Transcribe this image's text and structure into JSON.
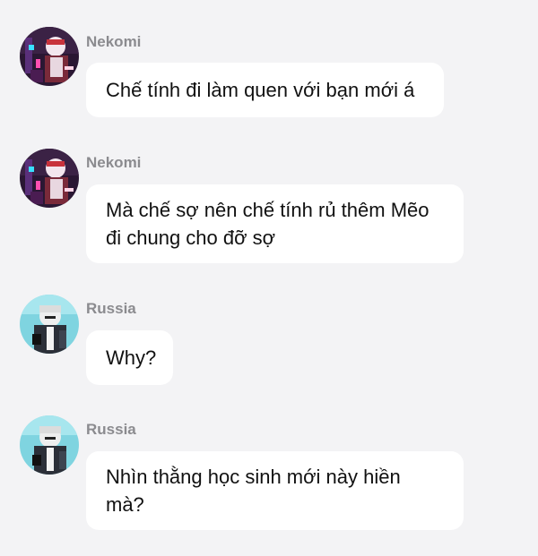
{
  "messages": [
    {
      "sender": "Nekomi",
      "avatar_icon": "nekomi-avatar-icon",
      "text": "Chế tính đi làm quen với bạn mới á"
    },
    {
      "sender": "Nekomi",
      "avatar_icon": "nekomi-avatar-icon",
      "text": "Mà chế sợ nên chế tính rủ thêm Mẽo đi chung cho đỡ sợ"
    },
    {
      "sender": "Russia",
      "avatar_icon": "russia-avatar-icon",
      "text": "Why?"
    },
    {
      "sender": "Russia",
      "avatar_icon": "russia-avatar-icon",
      "text": "Nhìn thằng học sinh mới này hiền mà?"
    }
  ],
  "colors": {
    "background": "#f3f3f5",
    "bubble": "#ffffff",
    "sender_name": "#8b8b8f",
    "message_text": "#111111"
  }
}
